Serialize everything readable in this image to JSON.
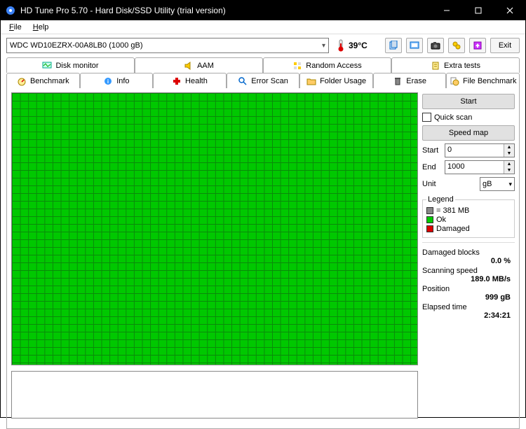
{
  "window": {
    "title": "HD Tune Pro 5.70 - Hard Disk/SSD Utility (trial version)"
  },
  "menu": {
    "file": "File",
    "help": "Help"
  },
  "toolbar": {
    "drive": "WDC WD10EZRX-00A8LB0 (1000 gB)",
    "temp": "39°C",
    "exit": "Exit"
  },
  "tabs": {
    "disk_monitor": "Disk monitor",
    "aam": "AAM",
    "random_access": "Random Access",
    "extra_tests": "Extra tests",
    "benchmark": "Benchmark",
    "info": "Info",
    "health": "Health",
    "error_scan": "Error Scan",
    "folder_usage": "Folder Usage",
    "erase": "Erase",
    "file_benchmark": "File Benchmark"
  },
  "sidebar": {
    "start": "Start",
    "quick_scan": "Quick scan",
    "speed_map": "Speed map",
    "start_lbl": "Start",
    "start_val": "0",
    "end_lbl": "End",
    "end_val": "1000",
    "unit_lbl": "Unit",
    "unit_val": "gB",
    "legend_title": "Legend",
    "legend_block": "= 381 MB",
    "legend_ok": "Ok",
    "legend_damaged": "Damaged",
    "damaged_blocks_lbl": "Damaged blocks",
    "damaged_blocks_val": "0.0 %",
    "scan_speed_lbl": "Scanning speed",
    "scan_speed_val": "189.0 MB/s",
    "position_lbl": "Position",
    "position_val": "999 gB",
    "elapsed_lbl": "Elapsed time",
    "elapsed_val": "2:34:21"
  }
}
